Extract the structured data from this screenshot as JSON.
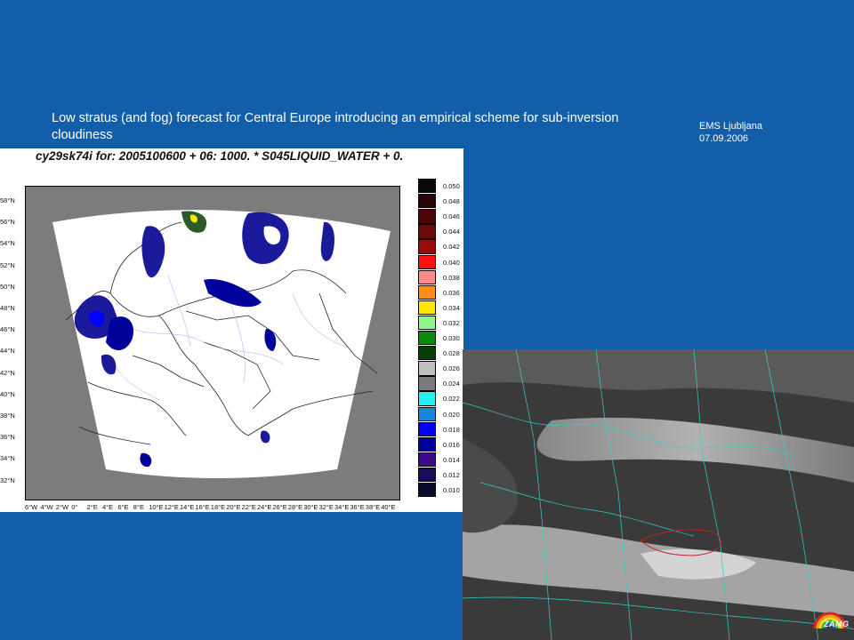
{
  "slide": {
    "title": "Low stratus (and fog) forecast for Central Europe introducing an empirical scheme for sub-inversion cloudiness",
    "event": "EMS Ljubljana",
    "date": "07.09.2006"
  },
  "model_plot": {
    "header": "cy29sk74i for: 2005100600 + 06: 1000. * S045LIQUID_WATER + 0.",
    "lat_labels": [
      "58°N",
      "56°N",
      "54°N",
      "52°N",
      "50°N",
      "48°N",
      "46°N",
      "44°N",
      "42°N",
      "40°N",
      "38°N",
      "36°N",
      "34°N",
      "32°N"
    ],
    "lon_labels": [
      "6°W",
      "4°W",
      "2°W",
      "0°",
      "2°E",
      "4°E",
      "6°E",
      "8°E",
      "10°E",
      "12°E",
      "14°E",
      "16°E",
      "18°E",
      "20°E",
      "22°E",
      "24°E",
      "26°E",
      "28°E",
      "30°E",
      "32°E",
      "34°E",
      "36°E",
      "38°E",
      "40°E"
    ],
    "colorbar": {
      "labels": [
        "0.050",
        "0.048",
        "0.046",
        "0.044",
        "0.042",
        "0.040",
        "0.038",
        "0.036",
        "0.034",
        "0.032",
        "0.030",
        "0.028",
        "0.026",
        "0.024",
        "0.022",
        "0.020",
        "0.018",
        "0.016",
        "0.014",
        "0.012",
        "0.010"
      ],
      "colors": [
        "#0a0a0a",
        "#2a0505",
        "#4a0808",
        "#6e0a0a",
        "#9a0a0a",
        "#ff1010",
        "#ff8a8a",
        "#ff8c1a",
        "#ffe800",
        "#8ef58e",
        "#0a8a0a",
        "#063f06",
        "#bebebe",
        "#7a7a7a",
        "#20f0f0",
        "#1a86d6",
        "#0000ff",
        "#00009a",
        "#3a0a8a",
        "#1a0a5a",
        "#0a0a2a"
      ]
    }
  },
  "satellite": {
    "logo_text": "ZAMG"
  },
  "colors": {
    "background": "#125ea8"
  }
}
